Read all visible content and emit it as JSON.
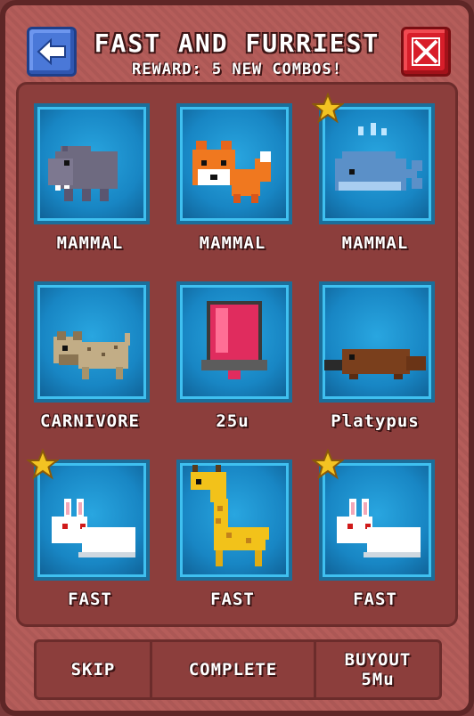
{
  "header": {
    "title": "FAST AND FURRIEST",
    "subtitle": "REWARD: 5 NEW COMBOS!"
  },
  "buttons": {
    "back_icon": "arrow-left-icon",
    "close_icon": "x-icon"
  },
  "grid": [
    {
      "label": "MAMMAL",
      "icon": "hippo-icon",
      "starred": false
    },
    {
      "label": "MAMMAL",
      "icon": "fox-icon",
      "starred": false
    },
    {
      "label": "MAMMAL",
      "icon": "whale-icon",
      "starred": true
    },
    {
      "label": "CARNIVORE",
      "icon": "hyena-icon",
      "starred": false
    },
    {
      "label": "25u",
      "icon": "red-gem-icon",
      "starred": false
    },
    {
      "label": "Platypus",
      "icon": "platypus-icon",
      "starred": false
    },
    {
      "label": "FAST",
      "icon": "rabbit-icon",
      "starred": true
    },
    {
      "label": "FAST",
      "icon": "giraffe-icon",
      "starred": false
    },
    {
      "label": "FAST",
      "icon": "rabbit-icon",
      "starred": true
    }
  ],
  "footer": {
    "skip": "SKIP",
    "complete": "COMPLETE",
    "buyout_line1": "BUYOUT",
    "buyout_line2": "5Mu"
  },
  "colors": {
    "frame": "#b55d5a",
    "tile": "#1886c4",
    "star": "#f3c322",
    "close": "#d81e2a",
    "back": "#4a78d8"
  }
}
